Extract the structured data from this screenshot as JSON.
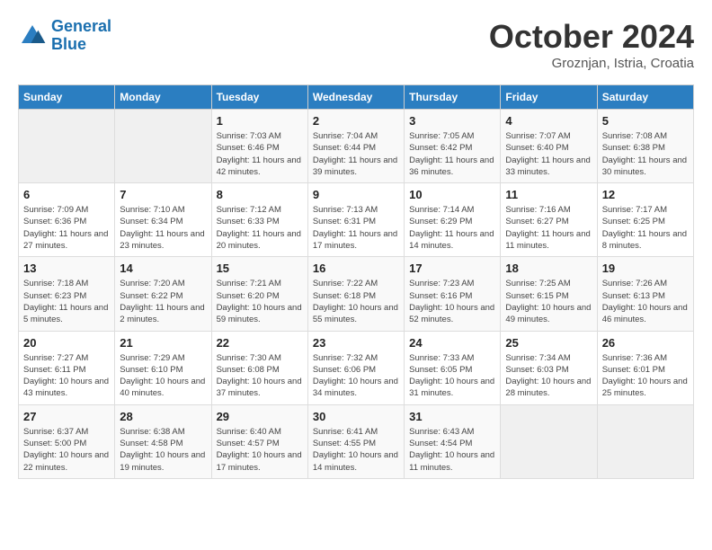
{
  "header": {
    "logo_line1": "General",
    "logo_line2": "Blue",
    "month": "October 2024",
    "location": "Groznjan, Istria, Croatia"
  },
  "weekdays": [
    "Sunday",
    "Monday",
    "Tuesday",
    "Wednesday",
    "Thursday",
    "Friday",
    "Saturday"
  ],
  "weeks": [
    [
      {
        "day": "",
        "info": ""
      },
      {
        "day": "",
        "info": ""
      },
      {
        "day": "1",
        "info": "Sunrise: 7:03 AM\nSunset: 6:46 PM\nDaylight: 11 hours and 42 minutes."
      },
      {
        "day": "2",
        "info": "Sunrise: 7:04 AM\nSunset: 6:44 PM\nDaylight: 11 hours and 39 minutes."
      },
      {
        "day": "3",
        "info": "Sunrise: 7:05 AM\nSunset: 6:42 PM\nDaylight: 11 hours and 36 minutes."
      },
      {
        "day": "4",
        "info": "Sunrise: 7:07 AM\nSunset: 6:40 PM\nDaylight: 11 hours and 33 minutes."
      },
      {
        "day": "5",
        "info": "Sunrise: 7:08 AM\nSunset: 6:38 PM\nDaylight: 11 hours and 30 minutes."
      }
    ],
    [
      {
        "day": "6",
        "info": "Sunrise: 7:09 AM\nSunset: 6:36 PM\nDaylight: 11 hours and 27 minutes."
      },
      {
        "day": "7",
        "info": "Sunrise: 7:10 AM\nSunset: 6:34 PM\nDaylight: 11 hours and 23 minutes."
      },
      {
        "day": "8",
        "info": "Sunrise: 7:12 AM\nSunset: 6:33 PM\nDaylight: 11 hours and 20 minutes."
      },
      {
        "day": "9",
        "info": "Sunrise: 7:13 AM\nSunset: 6:31 PM\nDaylight: 11 hours and 17 minutes."
      },
      {
        "day": "10",
        "info": "Sunrise: 7:14 AM\nSunset: 6:29 PM\nDaylight: 11 hours and 14 minutes."
      },
      {
        "day": "11",
        "info": "Sunrise: 7:16 AM\nSunset: 6:27 PM\nDaylight: 11 hours and 11 minutes."
      },
      {
        "day": "12",
        "info": "Sunrise: 7:17 AM\nSunset: 6:25 PM\nDaylight: 11 hours and 8 minutes."
      }
    ],
    [
      {
        "day": "13",
        "info": "Sunrise: 7:18 AM\nSunset: 6:23 PM\nDaylight: 11 hours and 5 minutes."
      },
      {
        "day": "14",
        "info": "Sunrise: 7:20 AM\nSunset: 6:22 PM\nDaylight: 11 hours and 2 minutes."
      },
      {
        "day": "15",
        "info": "Sunrise: 7:21 AM\nSunset: 6:20 PM\nDaylight: 10 hours and 59 minutes."
      },
      {
        "day": "16",
        "info": "Sunrise: 7:22 AM\nSunset: 6:18 PM\nDaylight: 10 hours and 55 minutes."
      },
      {
        "day": "17",
        "info": "Sunrise: 7:23 AM\nSunset: 6:16 PM\nDaylight: 10 hours and 52 minutes."
      },
      {
        "day": "18",
        "info": "Sunrise: 7:25 AM\nSunset: 6:15 PM\nDaylight: 10 hours and 49 minutes."
      },
      {
        "day": "19",
        "info": "Sunrise: 7:26 AM\nSunset: 6:13 PM\nDaylight: 10 hours and 46 minutes."
      }
    ],
    [
      {
        "day": "20",
        "info": "Sunrise: 7:27 AM\nSunset: 6:11 PM\nDaylight: 10 hours and 43 minutes."
      },
      {
        "day": "21",
        "info": "Sunrise: 7:29 AM\nSunset: 6:10 PM\nDaylight: 10 hours and 40 minutes."
      },
      {
        "day": "22",
        "info": "Sunrise: 7:30 AM\nSunset: 6:08 PM\nDaylight: 10 hours and 37 minutes."
      },
      {
        "day": "23",
        "info": "Sunrise: 7:32 AM\nSunset: 6:06 PM\nDaylight: 10 hours and 34 minutes."
      },
      {
        "day": "24",
        "info": "Sunrise: 7:33 AM\nSunset: 6:05 PM\nDaylight: 10 hours and 31 minutes."
      },
      {
        "day": "25",
        "info": "Sunrise: 7:34 AM\nSunset: 6:03 PM\nDaylight: 10 hours and 28 minutes."
      },
      {
        "day": "26",
        "info": "Sunrise: 7:36 AM\nSunset: 6:01 PM\nDaylight: 10 hours and 25 minutes."
      }
    ],
    [
      {
        "day": "27",
        "info": "Sunrise: 6:37 AM\nSunset: 5:00 PM\nDaylight: 10 hours and 22 minutes."
      },
      {
        "day": "28",
        "info": "Sunrise: 6:38 AM\nSunset: 4:58 PM\nDaylight: 10 hours and 19 minutes."
      },
      {
        "day": "29",
        "info": "Sunrise: 6:40 AM\nSunset: 4:57 PM\nDaylight: 10 hours and 17 minutes."
      },
      {
        "day": "30",
        "info": "Sunrise: 6:41 AM\nSunset: 4:55 PM\nDaylight: 10 hours and 14 minutes."
      },
      {
        "day": "31",
        "info": "Sunrise: 6:43 AM\nSunset: 4:54 PM\nDaylight: 10 hours and 11 minutes."
      },
      {
        "day": "",
        "info": ""
      },
      {
        "day": "",
        "info": ""
      }
    ]
  ]
}
